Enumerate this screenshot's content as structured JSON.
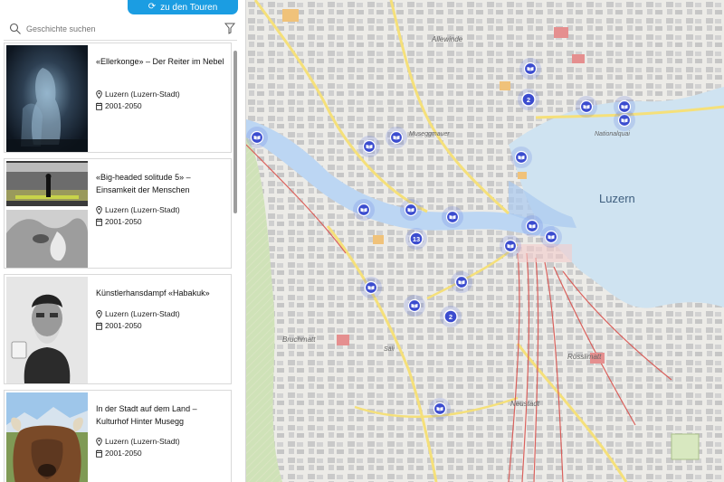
{
  "tour_button": {
    "label": "zu den Touren"
  },
  "search": {
    "placeholder": "Geschichte suchen"
  },
  "cards": [
    {
      "title": "«Ellerkonge» – Der Reiter im Nebel",
      "location": "Luzern (Luzern-Stadt)",
      "period": "2001-2050"
    },
    {
      "title": "«Big-headed solitude 5» – Einsamkeit der Menschen",
      "location": "Luzern (Luzern-Stadt)",
      "period": "2001-2050"
    },
    {
      "title": "Künstlerhansdampf «Habakuk»",
      "location": "Luzern (Luzern-Stadt)",
      "period": "2001-2050"
    },
    {
      "title": "In der Stadt auf dem Land – Kulturhof Hinter Musegg",
      "location": "Luzern (Luzern-Stadt)",
      "period": "2001-2050"
    }
  ],
  "map": {
    "city_label": "Luzern",
    "place_labels": [
      "Allewinde",
      "Museggmauer",
      "Nationalquai",
      "Bruchmatt",
      "Säli",
      "Rösslimatt",
      "Neustadt"
    ],
    "cluster_counts": [
      "2",
      "13",
      "2"
    ],
    "colors": {
      "water": "#cfe3f1",
      "highlight": "#bcd6f3",
      "marker": "#3b4ccf",
      "rail": "#d9534f",
      "road": "#f5e07a"
    }
  }
}
